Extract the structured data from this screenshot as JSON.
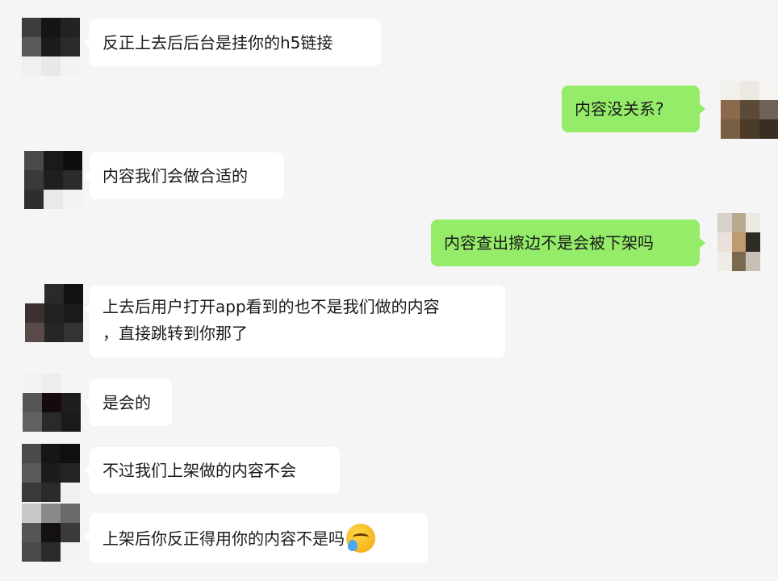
{
  "messages": [
    {
      "side": "left",
      "text": "反正上去后后台是挂你的h5链接"
    },
    {
      "side": "right",
      "text": "内容没关系?"
    },
    {
      "side": "left",
      "text": "内容我们会做合适的"
    },
    {
      "side": "right",
      "text": "内容查出擦边不是会被下架吗"
    },
    {
      "side": "left",
      "lines": [
        "上去后用户打开app看到的也不是我们做的内容",
        "，直接跳转到你那了"
      ]
    },
    {
      "side": "left",
      "text": "是会的"
    },
    {
      "side": "left",
      "text": "不过我们上架做的内容不会"
    },
    {
      "side": "left",
      "text": "上架后你反正得用你的内容不是吗",
      "emoji": "facepalm-cry-emoji"
    }
  ],
  "colors": {
    "background": "#f5f5f5",
    "bubble_self": "#95ec69",
    "bubble_other": "#ffffff"
  }
}
